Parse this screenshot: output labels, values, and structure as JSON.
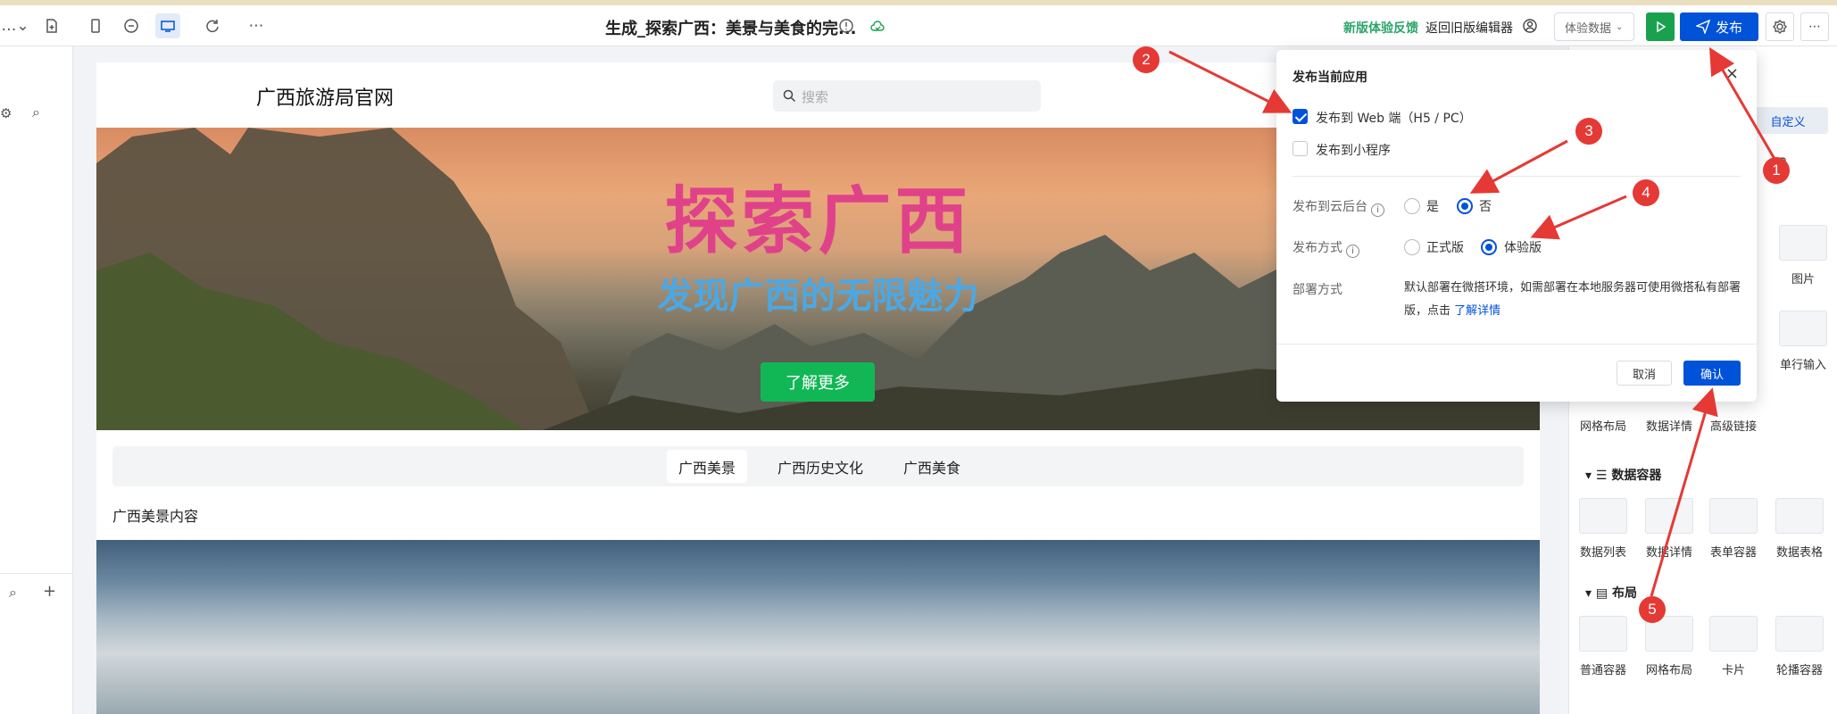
{
  "topbar": {
    "app_title": "生成_探索广西：美景与美食的完...",
    "feedback": "新版体验反馈",
    "old_editor": "返回旧版编辑器",
    "data_select": "体验数据",
    "publish": "发布"
  },
  "site": {
    "title": "广西旅游局官网",
    "search_placeholder": "搜索",
    "hero_title": "探索广西",
    "hero_subtitle": "发现广西的无限魅力",
    "hero_button": "了解更多",
    "tabs": [
      "广西美景",
      "广西历史文化",
      "广西美食"
    ],
    "tab_content": "广西美景内容"
  },
  "dialog": {
    "title": "发布当前应用",
    "web_option": "发布到 Web 端（H5 / PC）",
    "miniapp_option": "发布到小程序",
    "cloud_label": "发布到云后台",
    "cloud_yes": "是",
    "cloud_no": "否",
    "mode_label": "发布方式",
    "mode_formal": "正式版",
    "mode_trial": "体验版",
    "deploy_label": "部署方式",
    "deploy_text": "默认部署在微搭环境，如需部署在本地服务器可使用微搭私有部署版，点击",
    "deploy_link": "了解详情",
    "cancel": "取消",
    "confirm": "确认"
  },
  "right_panel": {
    "customize": "自定义",
    "items_top": [
      "图片",
      "单行输入"
    ],
    "row_layout": [
      "网格布局",
      "数据详情",
      "高级链接"
    ],
    "section_data": "数据容器",
    "row_data": [
      "数据列表",
      "数据详情",
      "表单容器",
      "数据表格"
    ],
    "section_layout": "布局",
    "row_layout2": [
      "普通容器",
      "网格布局",
      "卡片",
      "轮播容器"
    ]
  },
  "annotations": [
    "1",
    "2",
    "3",
    "4",
    "5"
  ],
  "colors": {
    "primary": "#0052d9",
    "green": "#12b755",
    "arrow": "#e53935"
  }
}
